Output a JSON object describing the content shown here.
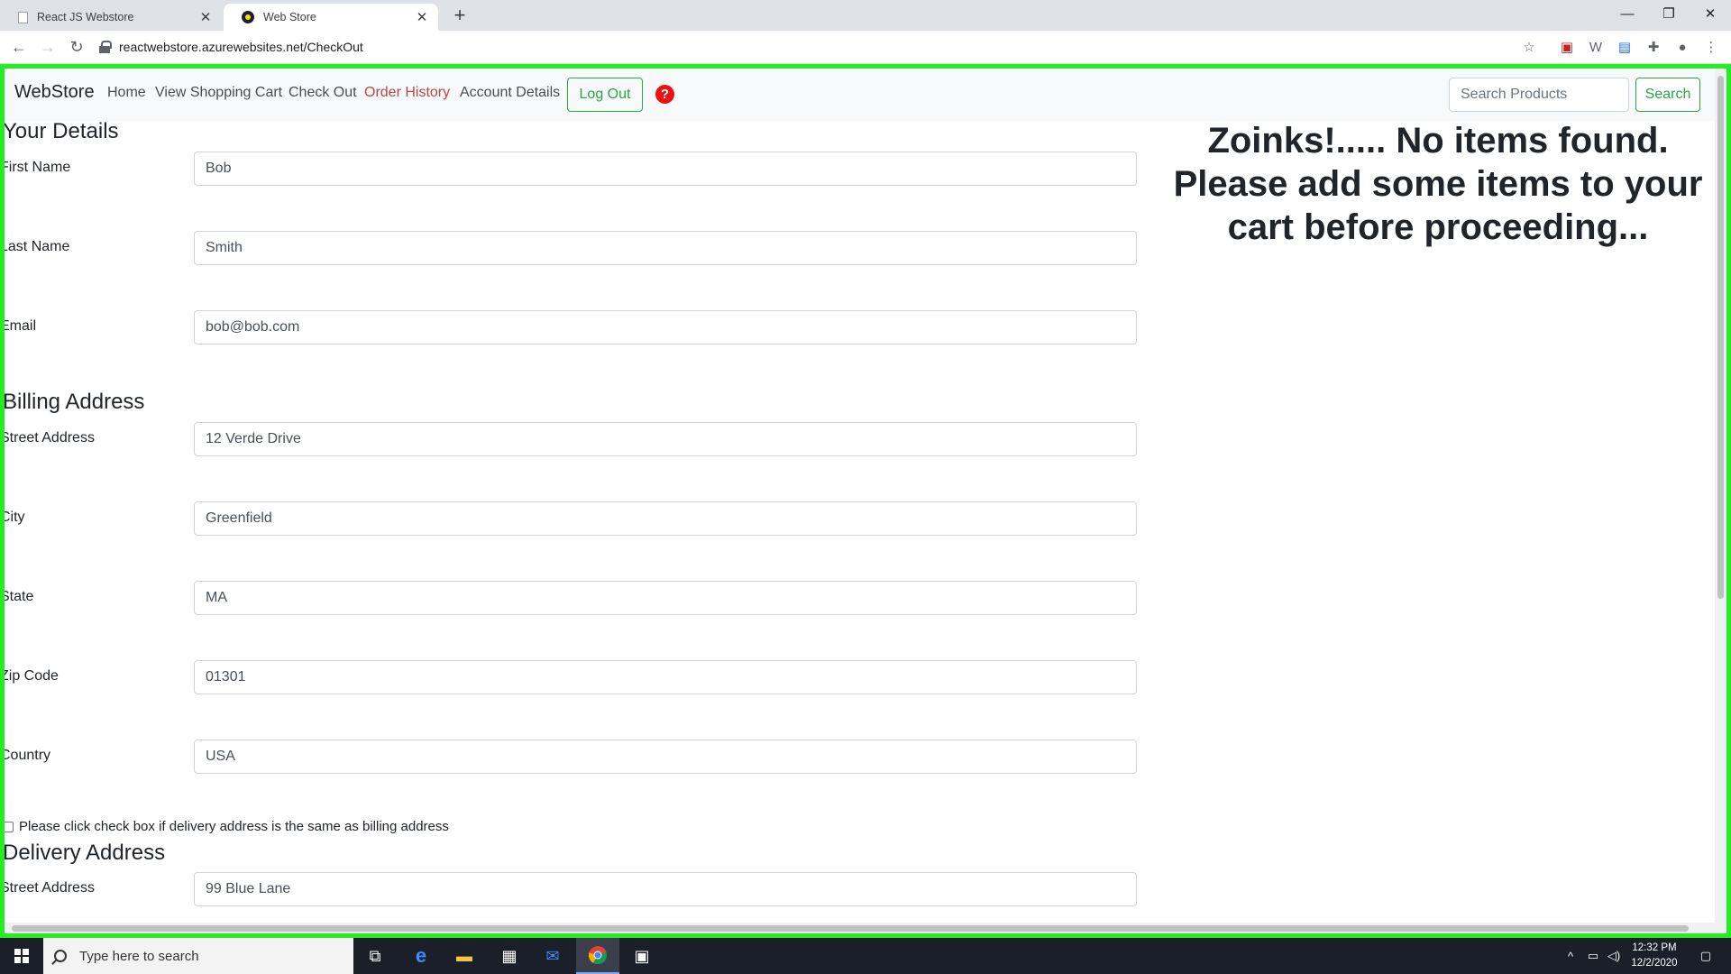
{
  "browser": {
    "tabs": [
      {
        "title": "React JS Webstore",
        "active": false
      },
      {
        "title": "Web Store",
        "active": true
      }
    ],
    "url": "reactwebstore.azurewebsites.net/CheckOut",
    "new_tab": "+",
    "close": "✕"
  },
  "navbar": {
    "brand": "WebStore",
    "links": [
      "Home",
      "View Shopping Cart",
      "Check Out",
      "Order History",
      "Account Details"
    ],
    "logout_label": "Log Out",
    "help_label": "?",
    "search_placeholder": "Search Products",
    "search_button": "Search",
    "hover_link": "Order History",
    "link_hover_color": "#b34a4a",
    "accent_color": "#28a745"
  },
  "your_details": {
    "title": "Your Details",
    "fields": [
      {
        "label": "First Name",
        "value": "Bob"
      },
      {
        "label": "Last Name",
        "value": "Smith"
      },
      {
        "label": "Email",
        "value": "bob@bob.com"
      }
    ]
  },
  "billing": {
    "title": "Billing Address",
    "fields": [
      {
        "label": "Street Address",
        "value": "12 Verde Drive"
      },
      {
        "label": "City",
        "value": "Greenfield"
      },
      {
        "label": "State",
        "value": "MA"
      },
      {
        "label": "Zip Code",
        "value": "01301"
      },
      {
        "label": "Country",
        "value": "USA"
      }
    ]
  },
  "same_address_checkbox": {
    "label": "Please click check box if delivery address is the same as billing address",
    "checked": false
  },
  "delivery": {
    "title": "Delivery Address",
    "fields": [
      {
        "label": "Street Address",
        "value": "99 Blue Lane"
      }
    ]
  },
  "empty_cart_message": "Zoinks!..... No items found. Please add some items to your cart before proceeding...",
  "taskbar": {
    "search_placeholder": "Type here to search",
    "time": "12:32 PM",
    "date": "12/2/2020"
  },
  "frame_color": "#22ee22"
}
